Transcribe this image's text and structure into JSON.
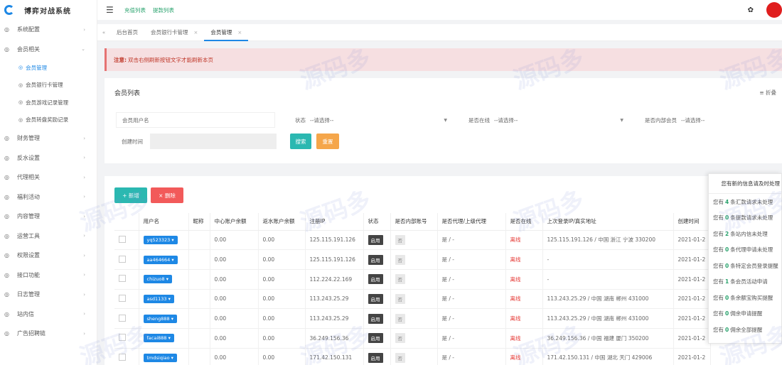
{
  "app": {
    "title": "博弈对战系统"
  },
  "header": {
    "links": [
      "充值列表",
      "提款列表"
    ]
  },
  "sidebar": {
    "items": [
      {
        "label": "系统配置",
        "expanded": false
      },
      {
        "label": "会员相关",
        "expanded": true,
        "children": [
          {
            "label": "会员管理",
            "active": true
          },
          {
            "label": "会员银行卡管理",
            "active": false
          },
          {
            "label": "会员游戏记录管理",
            "active": false
          },
          {
            "label": "会员转盘奖励记录",
            "active": false
          }
        ]
      },
      {
        "label": "财务管理",
        "expanded": false
      },
      {
        "label": "反水设置",
        "expanded": false
      },
      {
        "label": "代理相关",
        "expanded": false
      },
      {
        "label": "福利活动",
        "expanded": false
      },
      {
        "label": "内容管理",
        "expanded": false
      },
      {
        "label": "运营工具",
        "expanded": false
      },
      {
        "label": "权限设置",
        "expanded": false
      },
      {
        "label": "接口功能",
        "expanded": false
      },
      {
        "label": "日志管理",
        "expanded": false
      },
      {
        "label": "站内信",
        "expanded": false
      },
      {
        "label": "广告招聘链",
        "expanded": false
      }
    ]
  },
  "tabs": [
    {
      "label": "后台首页",
      "active": false,
      "closable": false
    },
    {
      "label": "会员银行卡管理",
      "active": false,
      "closable": true
    },
    {
      "label": "会员管理",
      "active": true,
      "closable": true
    }
  ],
  "notice": {
    "bold": "注意:",
    "text": "双击右侧刷新按钮文字才能刷新本页"
  },
  "search": {
    "title": "会员列表",
    "collapse_label": "折叠",
    "username_placeholder": "会员用户名",
    "status_label": "状态",
    "status_value": "--请选择--",
    "online_label": "是否在线",
    "online_value": "--请选择--",
    "internal_label": "是否内部会员",
    "internal_value": "--请选择--",
    "created_label": "创建时间",
    "search_button": "搜索",
    "reset_button": "重置"
  },
  "table": {
    "add_button": "+ 新增",
    "delete_button": "× 删除",
    "columns": [
      "用户名",
      "昵称",
      "中心账户余额",
      "返水账户余额",
      "注册IP",
      "状态",
      "是否内部账号",
      "是否代理/上级代理",
      "是否在线",
      "上次登录IP/真实地址",
      "创建时间"
    ],
    "rows": [
      {
        "username": "yq523323 ▾",
        "nickname": "",
        "center": "0.00",
        "rebate": "0.00",
        "ip": "125.115.191.126",
        "status": "启用",
        "internal": "否",
        "agent": "是 / -",
        "online": "离线",
        "last_ip": "125.115.191.126 / 中国 浙江 宁波 330200",
        "created": "2021-01-2"
      },
      {
        "username": "aa464664 ▾",
        "nickname": "",
        "center": "0.00",
        "rebate": "0.00",
        "ip": "125.115.191.126",
        "status": "启用",
        "internal": "否",
        "agent": "是 / -",
        "online": "离线",
        "last_ip": "-",
        "created": "2021-01-2"
      },
      {
        "username": "chizuo8 ▾",
        "nickname": "",
        "center": "0.00",
        "rebate": "0.00",
        "ip": "112.224.22.169",
        "status": "启用",
        "internal": "否",
        "agent": "是 / -",
        "online": "离线",
        "last_ip": "-",
        "created": "2021-01-2"
      },
      {
        "username": "asd1133 ▾",
        "nickname": "",
        "center": "0.00",
        "rebate": "0.00",
        "ip": "113.243.25.29",
        "status": "启用",
        "internal": "否",
        "agent": "是 / -",
        "online": "离线",
        "last_ip": "113.243.25.29 / 中国 湖南 郴州 431000",
        "created": "2021-01-2"
      },
      {
        "username": "sheng888 ▾",
        "nickname": "",
        "center": "0.00",
        "rebate": "0.00",
        "ip": "113.243.25.29",
        "status": "启用",
        "internal": "否",
        "agent": "是 / -",
        "online": "离线",
        "last_ip": "113.243.25.29 / 中国 湖南 郴州 431000",
        "created": "2021-01-2"
      },
      {
        "username": "facai888 ▾",
        "nickname": "",
        "center": "0.00",
        "rebate": "0.00",
        "ip": "36.249.156.36",
        "status": "启用",
        "internal": "否",
        "agent": "是 / -",
        "online": "离线",
        "last_ip": "36.249.156.36 / 中国 福建 厦门 350200",
        "created": "2021-01-2"
      },
      {
        "username": "tmdsiqiao ▾",
        "nickname": "",
        "center": "0.00",
        "rebate": "0.00",
        "ip": "171.42.150.131",
        "status": "启用",
        "internal": "否",
        "agent": "是 / -",
        "online": "离线",
        "last_ip": "171.42.150.131 / 中国 湖北 天门 429006",
        "created": "2021-01-2"
      }
    ]
  },
  "notifications": {
    "title": "您有新的信息请及时处理",
    "items": [
      {
        "prefix": "您有",
        "num": "4",
        "suffix": "条汇款请求未处理"
      },
      {
        "prefix": "您有",
        "num": "0",
        "suffix": "条提款请求未处理"
      },
      {
        "prefix": "您有",
        "num": "2",
        "suffix": "条站内信未处理"
      },
      {
        "prefix": "您有",
        "num": "0",
        "suffix": "条代理申请未处理"
      },
      {
        "prefix": "您有",
        "num": "0",
        "suffix": "条特定会员登录提醒"
      },
      {
        "prefix": "您有",
        "num": "1",
        "suffix": "条会员活动申请"
      },
      {
        "prefix": "您有",
        "num": "0",
        "suffix": "条余额宝购买提醒"
      },
      {
        "prefix": "您有",
        "num": "0",
        "suffix": "佣余申请提醒"
      },
      {
        "prefix": "您有",
        "num": "0",
        "suffix": "佣余全部提醒"
      }
    ]
  },
  "watermark": {
    "text": "源码多"
  }
}
